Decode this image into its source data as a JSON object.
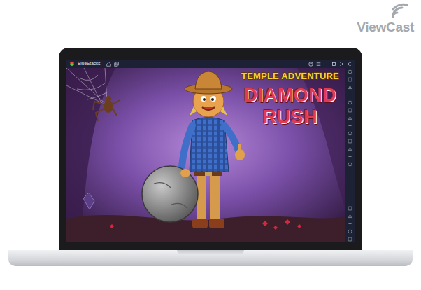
{
  "logo": {
    "text": "ViewCast"
  },
  "window": {
    "title": "BlueStacks"
  },
  "game": {
    "subtitle": "TEMPLE ADVENTURE",
    "title_lines": [
      "DIAMOND",
      "RUSH"
    ]
  }
}
